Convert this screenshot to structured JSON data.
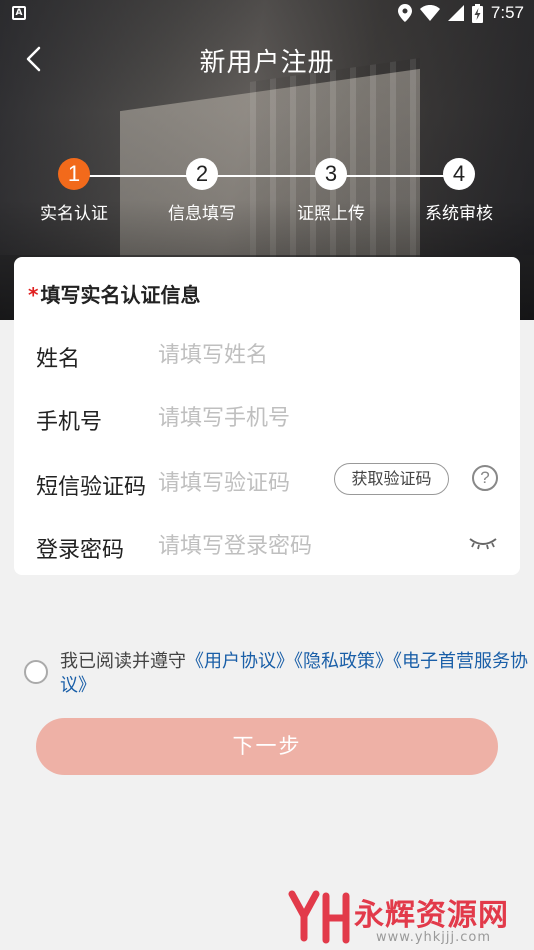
{
  "status_bar": {
    "left_icon": "A",
    "time": "7:57",
    "icons": [
      "location-icon",
      "wifi-icon",
      "signal-icon",
      "battery-charging-icon"
    ]
  },
  "nav": {
    "back_icon": "chevron-left-icon",
    "title": "新用户注册"
  },
  "steps": [
    {
      "number": "1",
      "label": "实名认证",
      "active": true
    },
    {
      "number": "2",
      "label": "信息填写",
      "active": false
    },
    {
      "number": "3",
      "label": "证照上传",
      "active": false
    },
    {
      "number": "4",
      "label": "系统审核",
      "active": false
    }
  ],
  "form": {
    "required_mark": "*",
    "title": "填写实名认证信息",
    "fields": [
      {
        "label": "姓名",
        "placeholder": "请填写姓名",
        "value": ""
      },
      {
        "label": "手机号",
        "placeholder": "请填写手机号",
        "value": ""
      },
      {
        "label": "短信验证码",
        "placeholder": "请填写验证码",
        "value": ""
      },
      {
        "label": "登录密码",
        "placeholder": "请填写登录密码",
        "value": ""
      }
    ],
    "get_code_label": "获取验证码",
    "help_icon_text": "?",
    "help_icon": "question-circle-icon",
    "eye_icon": "eye-closed-icon"
  },
  "agreement": {
    "checked": false,
    "prefix": "我已阅读并遵守",
    "user_agreement": "《用户协议》",
    "privacy_policy": "《隐私政策》",
    "esign_agreement": "《电子首营服务协议》"
  },
  "next_button": {
    "label": "下一步"
  },
  "watermark": {
    "text": "永辉资源网",
    "url": "www.yhkjjj.com"
  },
  "colors": {
    "accent": "#f26a1b",
    "button": "#eeb1a6",
    "link": "#1a5fa8",
    "required": "#e02020"
  }
}
